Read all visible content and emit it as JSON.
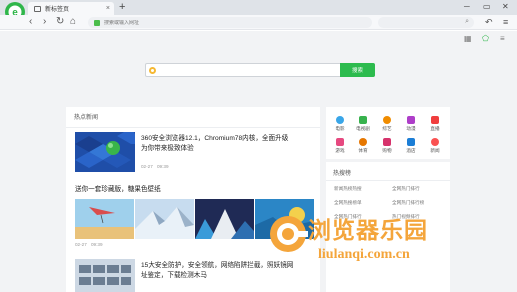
{
  "tabbar": {
    "tab_title": "新标签页",
    "new_tab": "+",
    "controls": {
      "minimize": "─",
      "maximize": "▭",
      "close": "✕"
    }
  },
  "toolbar": {
    "back": "‹",
    "forward": "›",
    "refresh": "↻",
    "home": "⌂",
    "address_placeholder": "搜索或输入网址",
    "undo": "↶",
    "menu": "≡"
  },
  "search": {
    "placeholder": "",
    "button": "搜索"
  },
  "news": {
    "title": "热点新闻",
    "items": [
      {
        "title_line1": "360安全浏览器12.1，Chromium78内核，全面升级",
        "title_line2": "为你带来极致体验",
        "date": "02-27",
        "time": "09:39"
      },
      {
        "title_line1": "送你一套珍藏版，糖果色壁纸",
        "date": "02-27",
        "time": "09:39"
      },
      {
        "title_line1": "15大安全防护，安全领航，网络陷阱拦截，照妖镜网",
        "title_line2": "址鉴定，下载检测木马"
      }
    ]
  },
  "apps": [
    {
      "label": "电影",
      "color": "#3aa6e8"
    },
    {
      "label": "电视剧",
      "color": "#37b24d"
    },
    {
      "label": "综艺",
      "color": "#f08c00"
    },
    {
      "label": "动漫",
      "color": "#ae3ec9"
    },
    {
      "label": "直播",
      "color": "#f03e3e"
    },
    {
      "label": "游戏",
      "color": "#e64980"
    },
    {
      "label": "体育",
      "color": "#e67700"
    },
    {
      "label": "购物",
      "color": "#d6336c"
    },
    {
      "label": "酒店",
      "color": "#1c7ed6"
    },
    {
      "label": "新闻",
      "color": "#fa5252"
    }
  ],
  "hot": {
    "title": "热搜榜",
    "items": [
      "新闻热榜热搜",
      "全网热门排行",
      "全网热搜榜单",
      "全网热门排行榜",
      "全网热门排行",
      "热门视频排行"
    ]
  },
  "watermark": {
    "cn": "浏览器乐园",
    "en": "liulanqi.com.cn"
  },
  "colors": {
    "accent": "#2dbb4e",
    "watermark": "#f4a53b"
  }
}
